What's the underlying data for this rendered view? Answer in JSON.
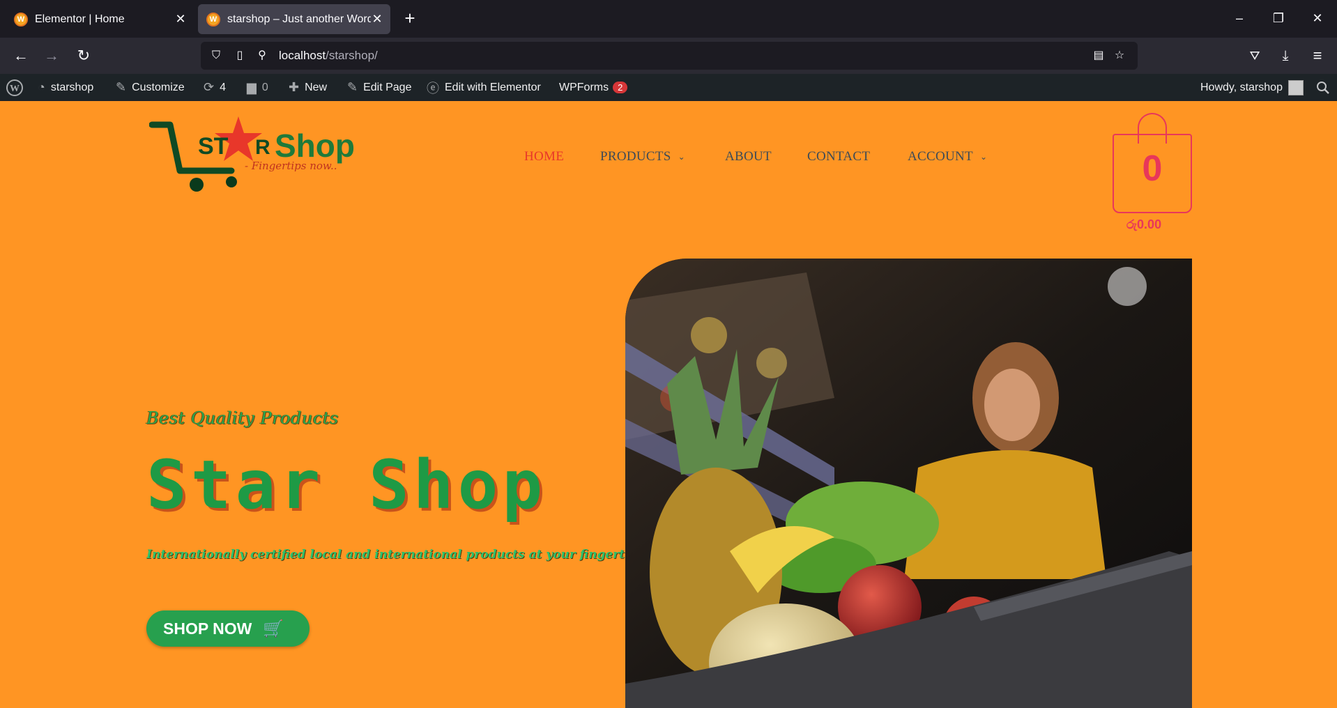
{
  "browser": {
    "tabs": [
      {
        "title": "Elementor | Home",
        "close": "✕"
      },
      {
        "title": "starshop – Just another WordPre",
        "close": "✕"
      }
    ],
    "new_tab": "+",
    "url": {
      "host": "localhost",
      "path": "/starshop/"
    }
  },
  "adminbar": {
    "site": "starshop",
    "customize": "Customize",
    "updates": "4",
    "comments": "0",
    "new": "New",
    "edit_page": "Edit Page",
    "edit_elementor": "Edit with Elementor",
    "wpforms": "WPForms",
    "wpforms_badge": "2",
    "howdy": "Howdy, starshop"
  },
  "header": {
    "logo": {
      "star": "ST",
      "star_r": "R",
      "shop": "Shop",
      "tagline": "- Fingertips now.."
    },
    "nav": [
      "HOME",
      "PRODUCTS",
      "ABOUT",
      "CONTACT",
      "ACCOUNT"
    ],
    "cart": {
      "count": "0",
      "total": "රු0.00"
    }
  },
  "hero": {
    "subtitle": "Best Quality Products",
    "title": "Star Shop",
    "description": "Internationally certified local and international products at your fingertips....!",
    "button": "SHOP NOW"
  },
  "colors": {
    "accent": "#ff9523",
    "brand_green": "#1e9a45",
    "nav_active": "#e8372a",
    "cart": "#e8375a"
  }
}
